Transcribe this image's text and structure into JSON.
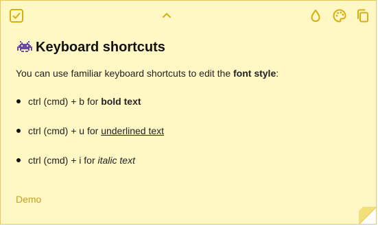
{
  "toolbar": {
    "icons": {
      "left": "checkbox-icon",
      "center": "chevron-up-icon",
      "color": "droplet-icon",
      "palette": "palette-icon",
      "copy": "copy-icon"
    }
  },
  "note": {
    "title_emoji": "space-invader-icon",
    "title": "Keyboard shortcuts",
    "intro_prefix": "You can use familiar keyboard shortcuts to edit the ",
    "intro_bold": "font style",
    "intro_suffix": ":",
    "shortcuts": [
      {
        "prefix": "ctrl (cmd) + b for ",
        "styled": "bold text",
        "style": "bold"
      },
      {
        "prefix": "ctrl (cmd) + u for ",
        "styled": "underlined text",
        "style": "underline"
      },
      {
        "prefix": "ctrl (cmd) + i for ",
        "styled": "italic text",
        "style": "italic"
      }
    ],
    "footer": "Demo"
  },
  "colors": {
    "background": "#fff7c4",
    "accent": "#d4af0f",
    "border": "#e6c95a",
    "footer_text": "#c2a21a"
  }
}
